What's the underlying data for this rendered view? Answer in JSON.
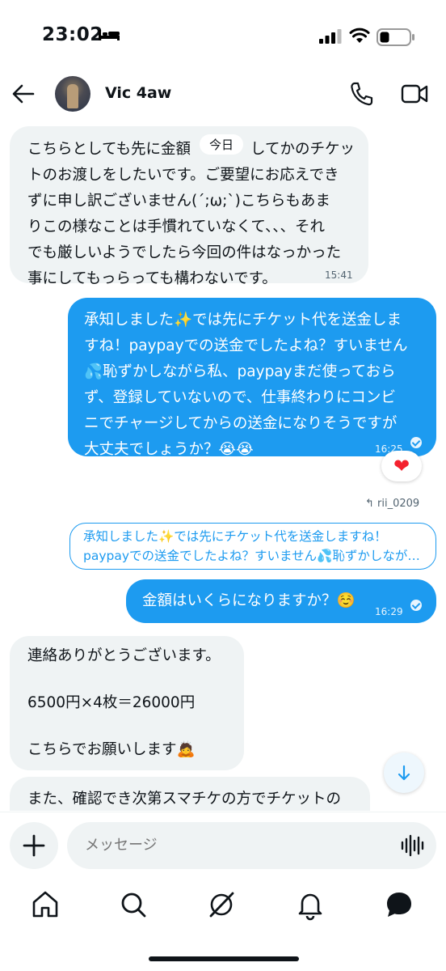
{
  "status": {
    "time": "23:02"
  },
  "header": {
    "name": "Vic 4aw"
  },
  "date_divider": "今日",
  "messages": [
    {
      "side": "in",
      "text": "こちらとしても先に金額を確認してかのチケットのお渡しをしたいです。ご要望にお応えできずに申し訳ございません(´;ω;`)こちらもあまりこの様なことは手慣れていなくて、、、それでも厳しいようでしたら今回の件はなかった事にしてもっらっても構わないです。",
      "lines": [
        "こちらとしても先に金額　　　　してかのチケッ",
        "トのお渡しをしたいです。ご要望にお応えでき",
        "ずに申し訳ございません(´;ω;`)こちらもあま",
        "りこの様なことは手慣れていなくて、、、それ",
        "でも厳しいようでしたら今回の件はなっかった",
        "事にしてもっらっても構わないです。"
      ],
      "time": "15:41"
    },
    {
      "side": "out",
      "lines": [
        "承知しました✨では先にチケット代を送金しま",
        "すね！paypayでの送金でしたよね？すいません",
        "💦恥ずかしながら私、paypayまだ使っておら",
        "ず、登録していないので、仕事終わりにコンビ",
        "ニでチャージしてからの送金になりそうですが",
        "大丈夫でしょうか？😭😭"
      ],
      "time": "16:25",
      "reaction": "❤"
    },
    {
      "side": "out",
      "reply_to": "rii_0209",
      "quote_lines": [
        "承知しました✨では先にチケット代を送金しますね！",
        "paypayでの送金でしたよね？すいません💦恥ずかしなが…"
      ],
      "text": "金額はいくらになりますか？☺️",
      "time": "16:29"
    },
    {
      "side": "in",
      "lines": [
        "連絡ありがとうございます。",
        "",
        "6500円×4枚＝26000円",
        "",
        "こちらでお願いします🙇"
      ]
    },
    {
      "side": "in",
      "lines": [
        "また、確認でき次第スマチケの方でチケットの"
      ]
    }
  ],
  "composer": {
    "placeholder": "メッセージ"
  },
  "colors": {
    "accent": "#1d9bf0",
    "incoming_bg": "#eff3f4",
    "text": "#0f1419",
    "muted": "#536471"
  },
  "icons": {
    "back": "back-arrow-icon",
    "call": "phone-icon",
    "video": "video-icon",
    "add": "plus-icon",
    "voice": "mic-icon",
    "scroll": "arrow-down-icon"
  }
}
